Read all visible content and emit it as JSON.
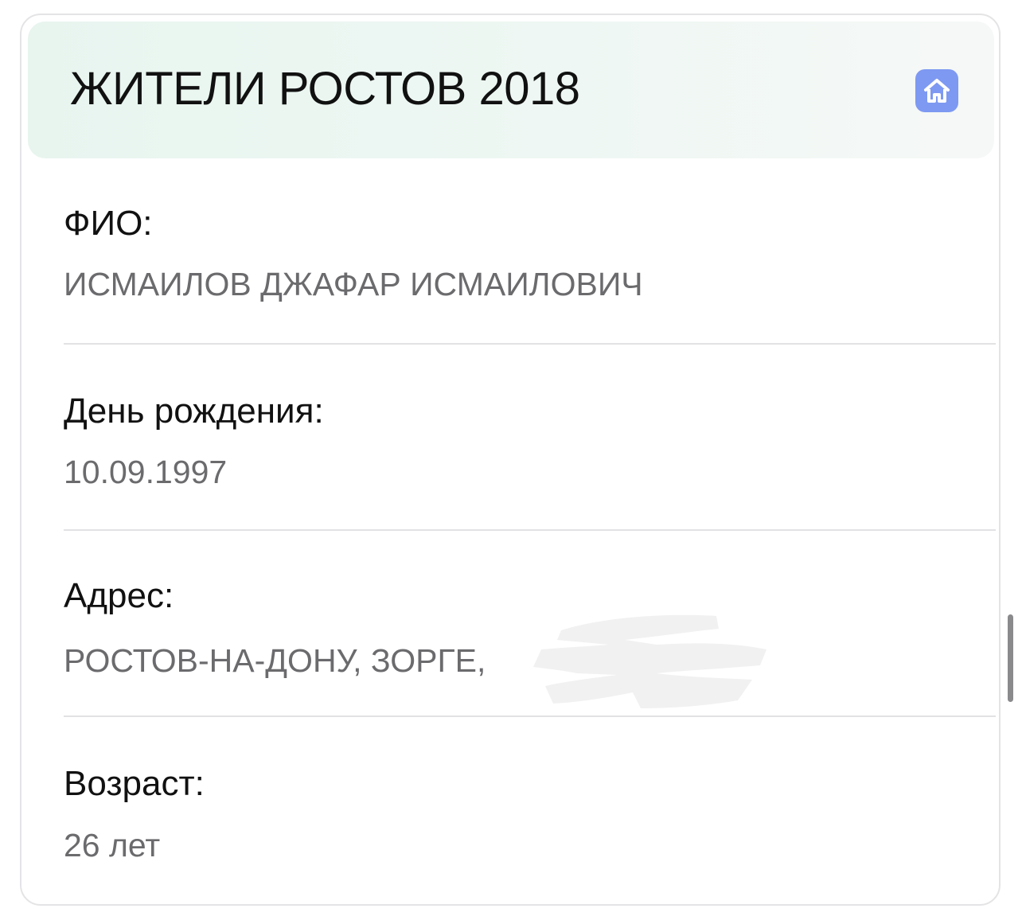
{
  "header": {
    "title": "ЖИТЕЛИ РОСТОВ 2018",
    "home_icon": "home-icon"
  },
  "fields": [
    {
      "label": "ФИО:",
      "value": "ИСМАИЛОВ ДЖАФАР ИСМАИЛОВИЧ"
    },
    {
      "label": "День рождения:",
      "value": "10.09.1997"
    },
    {
      "label": "Адрес:",
      "value": "РОСТОВ-НА-ДОНУ, ЗОРГЕ,"
    },
    {
      "label": "Возраст:",
      "value": "26 лет"
    }
  ],
  "colors": {
    "header_bg": "#e8f5ef",
    "accent": "#7e99f2",
    "label_text": "#111111",
    "value_text": "#6b6b6e",
    "divider": "#e2e2e4"
  }
}
